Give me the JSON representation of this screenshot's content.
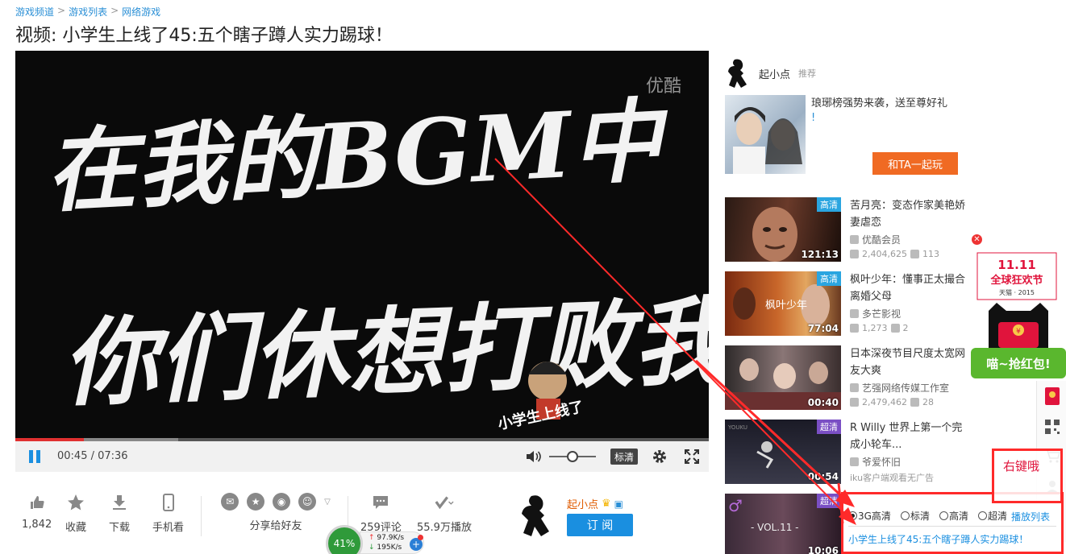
{
  "breadcrumb": {
    "items": [
      "游戏频道",
      "游戏列表",
      "网络游戏"
    ],
    "separator": ">"
  },
  "title": "视频: 小学生上线了45:五个瞎子蹲人实力踢球！",
  "player": {
    "video_text_line1": "在我的BGM中",
    "video_text_line2": "你们休想打败我",
    "watermark": "优酷",
    "sticker": "小学生上线了",
    "current_time": "00:45",
    "duration": "07:36",
    "time_display": "00:45 / 07:36",
    "progress_fraction": 0.099,
    "buffer_fraction": 0.235,
    "volume_fraction": 0.5,
    "quality_label": "标清",
    "progress_color": "#e03030"
  },
  "actions": {
    "like_count": "1,842",
    "favorite_label": "收藏",
    "download_label": "下载",
    "mobile_label": "手机看",
    "share_label": "分享给好友",
    "comments_label": "259评论",
    "plays_label": "55.9万播放"
  },
  "uploader": {
    "name": "起小点",
    "subscribe_label": "订 阅"
  },
  "speed_widget": {
    "percent": "41%",
    "up": "97.9K/s",
    "down": "195K/s",
    "plus": "+"
  },
  "sidebar": {
    "rec_name": "起小点",
    "rec_tag": "推荐",
    "promo_text": "琅琊榜强势来袭，送至尊好礼",
    "promo_excl": "!",
    "promo_button": "和TA一起玩",
    "videos": [
      {
        "badge": "高清",
        "duration": "121:13",
        "title": "苦月亮：变态作家美艳娇妻虐恋",
        "author": "优酷会员",
        "views": "2,404,625",
        "comments": "113"
      },
      {
        "badge": "高清",
        "duration": "77:04",
        "title": "枫叶少年：懂事正太撮合离婚父母",
        "author": "多芒影视",
        "views": "1,273",
        "comments": "2",
        "thumb_text": "枫叶少年"
      },
      {
        "badge": "",
        "duration": "00:40",
        "title": "日本深夜节目尺度太宽网友大爽",
        "author": "艺强网络传媒工作室",
        "views": "2,479,462",
        "comments": "28"
      },
      {
        "badge": "超清",
        "duration": "00:54",
        "title": "R Willy 世界上第一个完成小轮车...",
        "author": "爷爱怀旧",
        "stats_text": "iku客户端观看无广告",
        "thumb_text": "YOUKU"
      },
      {
        "badge": "超清",
        "duration": "10:06",
        "title": "",
        "author": "",
        "thumb_text": "- VOL.11 -"
      }
    ]
  },
  "ad": {
    "close": "✕",
    "date": "11.11",
    "slogan": "全球狂欢节",
    "brand": "天猫 · 2015",
    "redpacket": "喵~抢红包!",
    "coin": "¥"
  },
  "annotation": {
    "label": "右键哦",
    "color": "#ff2a2a"
  },
  "quality_menu": {
    "options": [
      "3G高清",
      "标清",
      "高清",
      "超清"
    ],
    "selected": "3G高清",
    "playlist": "播放列表",
    "now_playing": "小学生上线了45:五个瞎子蹲人实力踢球！"
  }
}
